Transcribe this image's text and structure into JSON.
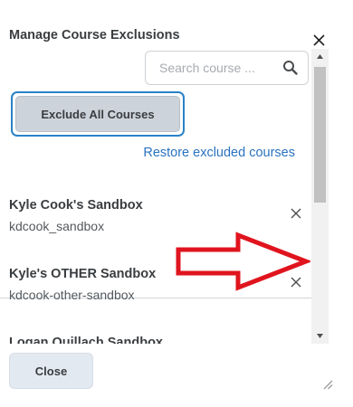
{
  "dialog": {
    "title": "Manage Course Exclusions",
    "close_icon": "close-icon"
  },
  "search": {
    "placeholder": "Search course ...",
    "value": "",
    "icon": "search-icon"
  },
  "actions": {
    "exclude_all_label": "Exclude All Courses",
    "restore_label": "Restore excluded courses"
  },
  "courses": [
    {
      "name": "Kyle Cook's Sandbox",
      "code": "kdcook_sandbox"
    },
    {
      "name": "Kyle's OTHER Sandbox",
      "code": "kdcook-other-sandbox"
    },
    {
      "name": "Logan Quillach Sandbox",
      "code": ""
    }
  ],
  "footer": {
    "close_label": "Close"
  },
  "colors": {
    "accent": "#2a73c0",
    "focus_ring": "#2a82c6",
    "annotation_arrow": "#e0141e",
    "button_bg": "#cdd3da"
  }
}
